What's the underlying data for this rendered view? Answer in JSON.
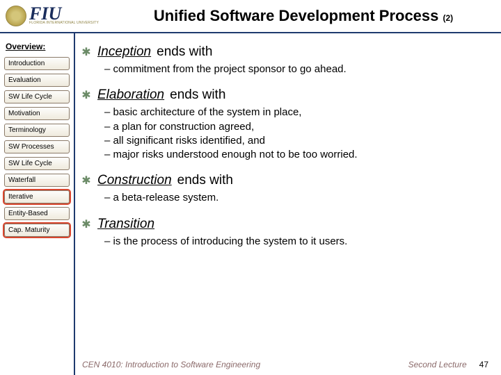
{
  "header": {
    "logo_name": "FIU",
    "logo_sub": "FLORIDA INTERNATIONAL UNIVERSITY",
    "title_main": "Unified Software Development Process",
    "title_sub": "(2)"
  },
  "sidebar": {
    "heading": "Overview:",
    "items": [
      {
        "label": "Introduction",
        "hl": false
      },
      {
        "label": "Evaluation",
        "hl": false
      },
      {
        "label": "SW Life Cycle",
        "hl": false
      },
      {
        "label": "Motivation",
        "hl": false
      },
      {
        "label": "Terminology",
        "hl": false
      },
      {
        "label": "SW Processes",
        "hl": false
      },
      {
        "label": "SW Life Cycle",
        "hl": false
      },
      {
        "label": "Waterfall",
        "hl": false
      },
      {
        "label": "Iterative",
        "hl": true
      },
      {
        "label": "Entity-Based",
        "hl": false
      },
      {
        "label": "Cap. Maturity",
        "hl": true
      }
    ]
  },
  "content": {
    "sections": [
      {
        "phase": "Inception",
        "tail": " ends with",
        "points": [
          "commitment from the project sponsor to go ahead."
        ]
      },
      {
        "phase": "Elaboration",
        "tail": " ends with",
        "points": [
          "basic architecture of the system in place,",
          "a plan for construction agreed,",
          "all significant risks identified, and",
          "major risks understood enough not to be too worried."
        ]
      },
      {
        "phase": "Construction",
        "tail": " ends with",
        "points": [
          "a beta-release system."
        ]
      },
      {
        "phase": "Transition",
        "tail": "",
        "points": [
          "is the process of introducing the system to it users."
        ]
      }
    ]
  },
  "footer": {
    "course": "CEN 4010: Introduction to Software Engineering",
    "lecture": "Second Lecture",
    "page": "47"
  }
}
